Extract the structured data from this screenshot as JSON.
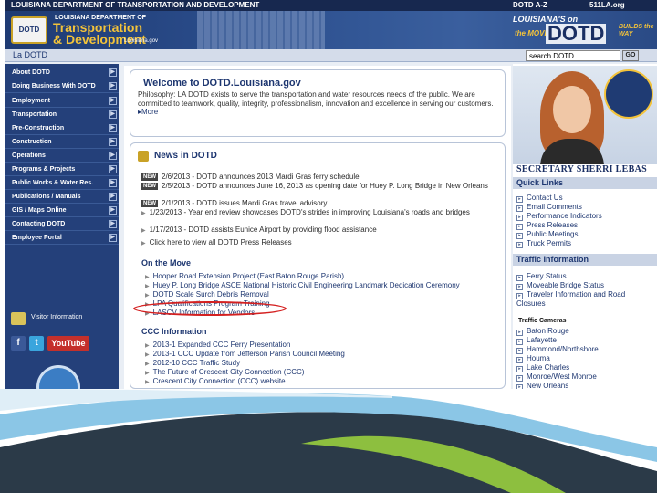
{
  "topbar": {
    "agency": "LOUISIANA DEPARTMENT OF TRANSPORTATION AND DEVELOPMENT",
    "az": "DOTD A-Z",
    "phone": "511LA.org"
  },
  "banner": {
    "logo": "DOTD",
    "agency_top": "LOUISIANA DEPARTMENT OF",
    "agency_line1": "Transportation",
    "agency_line2": "& Development",
    "tagline": "Louisiana.gov",
    "slogan_top": "LOUISIANA'S on",
    "slogan_mid": "the MOVE",
    "slogan_brand": "DOTD",
    "slogan_right": "BUILDS the WAY"
  },
  "crumb": {
    "label": "La DOTD",
    "search_value": "search DOTD",
    "go": "GO"
  },
  "nav": {
    "items": [
      "About DOTD",
      "Doing Business With DOTD",
      "Employment",
      "Transportation",
      "Pre-Construction",
      "Construction",
      "Operations",
      "Programs & Projects",
      "Public Works & Water Res.",
      "Publications / Manuals",
      "GIS / Maps Online",
      "Contacting DOTD",
      "Employee Portal"
    ],
    "visitor": "Visitor Information",
    "social": [
      "f",
      "t",
      "YouTube"
    ]
  },
  "welcome": {
    "title": "Welcome to DOTD.Louisiana.gov",
    "text": "Philosophy: LA DOTD exists to serve the transportation and water resources needs of the public. We are committed to teamwork, quality, integrity, professionalism, innovation and excellence in serving our customers.",
    "more": "More"
  },
  "news": {
    "title": "News in DOTD",
    "badge": "NEW",
    "items": [
      "2/6/2013 - DOTD announces 2013 Mardi Gras ferry schedule",
      "2/5/2013 - DOTD announces June 16, 2013 as opening date for Huey P. Long Bridge in New Orleans",
      "2/1/2013 - DOTD issues Mardi Gras travel advisory",
      "1/23/2013 - Year end review showcases DOTD's strides in improving Louisiana's roads and bridges",
      "1/17/2013 - DOTD assists Eunice Airport by providing flood assistance"
    ],
    "all_link": "Click here to view all DOTD Press Releases"
  },
  "on_the_move": {
    "title": "On the Move",
    "items": [
      "Hooper Road Extension Project (East Baton Rouge Parish)",
      "Huey P. Long Bridge ASCE National Historic Civil Engineering Landmark Dedication Ceremony",
      "DOTD Scale Surch Debris Removal",
      "LPA Qualifications Program Training",
      "LASCV Information for Vendors"
    ]
  },
  "ccc": {
    "title": "CCC Information",
    "items": [
      "2013-1 Expanded CCC Ferry Presentation",
      "2013-1 CCC Update from Jefferson Parish Council Meeting",
      "2012-10 CCC Traffic Study",
      "The Future of Crescent City Connection (CCC)",
      "Crescent City Connection (CCC) website"
    ]
  },
  "right": {
    "secretary": "SECRETARY SHERRI LEBAS",
    "quick_links_title": "Quick Links",
    "quick_links": [
      "Contact Us",
      "Email Comments",
      "Performance Indicators",
      "Press Releases",
      "Public Meetings",
      "Truck Permits"
    ],
    "traffic_title": "Traffic Information",
    "traffic_links": [
      "Ferry Status",
      "Moveable Bridge Status",
      "Traveler Information and Road Closures"
    ],
    "cameras_title": "Traffic Cameras",
    "cameras": [
      "Baton Rouge",
      "Lafayette",
      "Hammond/Northshore",
      "Houma",
      "Lake Charles",
      "Monroe/West Monroe",
      "New Orleans"
    ]
  },
  "colors": {
    "navy": "#24407a",
    "gold": "#f3c33a",
    "highlight": "#d42020"
  }
}
